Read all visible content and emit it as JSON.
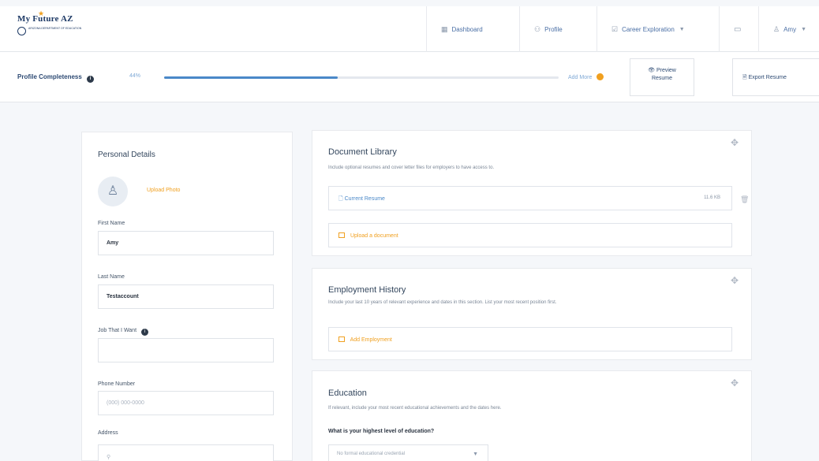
{
  "logo": {
    "title": "My Future AZ",
    "subtitle": "Arizona Department of Education"
  },
  "nav": {
    "dashboard": "Dashboard",
    "profile": "Profile",
    "career": "Career Exploration",
    "user": "Amy"
  },
  "progress": {
    "label": "Profile Completeness",
    "percent_text": "44%",
    "percent_value": 0.44,
    "add_more": "Add More",
    "preview_line1": "Preview",
    "preview_line2": "Resume",
    "export": "Export Resume"
  },
  "personal": {
    "title": "Personal Details",
    "upload_photo": "Upload Photo",
    "first_name_label": "First Name",
    "first_name": "Amy",
    "last_name_label": "Last Name",
    "last_name": "Testaccount",
    "job_label": "Job That I Want",
    "job_value": "",
    "phone_label": "Phone Number",
    "phone_placeholder": "(000) 000-0000",
    "address_label": "Address"
  },
  "documents": {
    "title": "Document Library",
    "desc": "Include optional resumes and cover letter files for employers to have access to.",
    "current_resume": "Current Resume",
    "size": "11.6 KB",
    "upload": "Upload a document"
  },
  "employment": {
    "title": "Employment History",
    "desc": "Include your last 10 years of relevant experience and dates in this section. List your most recent position first.",
    "add": "Add Employment"
  },
  "education": {
    "title": "Education",
    "desc": "If relevant, include your most recent educational achievements and the dates here.",
    "question": "What is your highest level of education?",
    "select_value": "No formal educational credential"
  },
  "colors": {
    "accent": "#4a88c8",
    "orange": "#f0a020",
    "navy": "#1e3a66"
  }
}
